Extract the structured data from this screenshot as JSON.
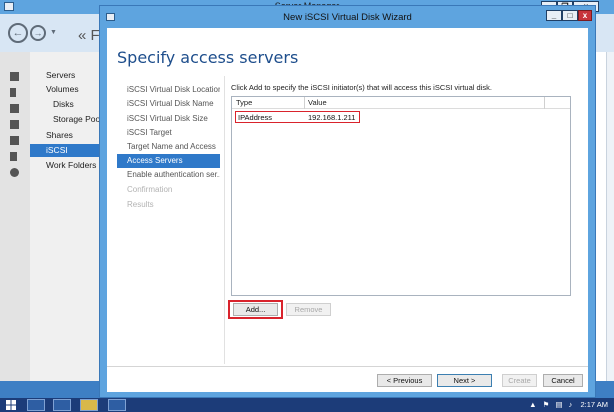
{
  "server_manager": {
    "title": "Server Manager",
    "breadcrumb": "« F",
    "nav_items": [
      "Servers",
      "Volumes",
      "Disks",
      "Storage Poo",
      "Shares",
      "iSCSI",
      "Work Folders"
    ],
    "selected_item": "iSCSI"
  },
  "wizard": {
    "title": "New iSCSI Virtual Disk Wizard",
    "heading": "Specify access servers",
    "steps": [
      {
        "label": "iSCSI Virtual Disk Location",
        "state": "normal"
      },
      {
        "label": "iSCSI Virtual Disk Name",
        "state": "normal"
      },
      {
        "label": "iSCSI Virtual Disk Size",
        "state": "normal"
      },
      {
        "label": "iSCSI Target",
        "state": "normal"
      },
      {
        "label": "Target Name and Access",
        "state": "normal"
      },
      {
        "label": "Access Servers",
        "state": "active"
      },
      {
        "label": "Enable authentication ser...",
        "state": "normal"
      },
      {
        "label": "Confirmation",
        "state": "disabled"
      },
      {
        "label": "Results",
        "state": "disabled"
      }
    ],
    "instruction": "Click Add to specify the iSCSI initiator(s) that will access this iSCSI virtual disk.",
    "table": {
      "columns": [
        "Type",
        "Value"
      ],
      "rows": [
        [
          "IPAddress",
          "192.168.1.211"
        ]
      ]
    },
    "add_button": "Add...",
    "remove_button": "Remove",
    "previous_button": "< Previous",
    "next_button": "Next >",
    "create_button": "Create",
    "cancel_button": "Cancel"
  },
  "taskbar": {
    "clock": "2:17 AM"
  },
  "colors": {
    "accent": "#2f79c9",
    "titlebar": "#5ea4df",
    "highlight": "#d9232c",
    "taskbar": "#1c3c79"
  }
}
